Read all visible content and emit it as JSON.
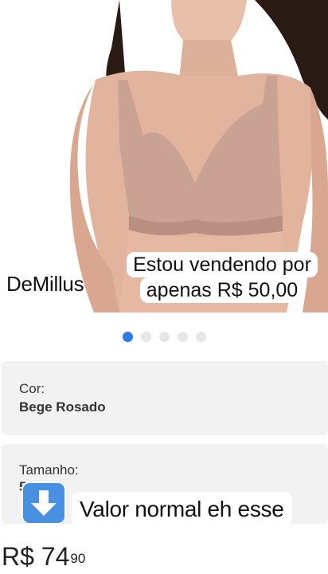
{
  "product": {
    "image_alt": "Woman wearing beige bra",
    "brand_caption": "DeMillus",
    "sale_caption_line1": "Estou vendendo por",
    "sale_caption_line2": "apenas R$ 50,00"
  },
  "carousel": {
    "total": 5,
    "active_index": 0
  },
  "color_option": {
    "label": "Cor:",
    "value": "Bege Rosado"
  },
  "size_option": {
    "label": "Tamanho:",
    "value": "5"
  },
  "overlay": {
    "emoji_icon": "down-arrow-emoji-icon",
    "text": "Valor normal eh esse"
  },
  "price": {
    "currency_int": "R$ 74",
    "cents": "90"
  },
  "colors": {
    "accent": "#2f7be5",
    "card_bg": "#f2f2f3",
    "emoji_blue": "#4a90e2"
  }
}
